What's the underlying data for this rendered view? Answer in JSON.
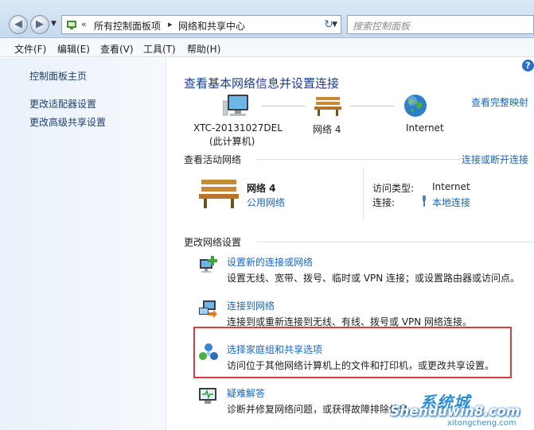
{
  "address": {
    "recent_symbol": "«",
    "crumbs": [
      "所有控制面板项",
      "网络和共享中心"
    ],
    "search_placeholder": "搜索控制面板"
  },
  "menu": [
    "文件(F)",
    "编辑(E)",
    "查看(V)",
    "工具(T)",
    "帮助(H)"
  ],
  "sidebar": {
    "home": "控制面板主页",
    "items": [
      "更改适配器设置",
      "更改高级共享设置"
    ]
  },
  "main": {
    "title": "查看基本网络信息并设置连接",
    "full_map_link": "查看完整映射",
    "nodes": [
      {
        "label": "XTC-20131027DEL",
        "sublabel": "(此计算机)",
        "icon": "computer-icon"
      },
      {
        "label": "网络  4",
        "icon": "bench-icon"
      },
      {
        "label": "Internet",
        "icon": "globe-icon"
      }
    ],
    "active_networks_label": "查看活动网络",
    "connect_disconnect_link": "连接或断开连接",
    "network": {
      "name": "网络  4",
      "type_link": "公用网络",
      "access_type_label": "访问类型:",
      "access_type_value": "Internet",
      "connection_label": "连接:",
      "connection_value": "本地连接"
    },
    "change_settings_label": "更改网络设置",
    "tasks": [
      {
        "title": "设置新的连接或网络",
        "desc": "设置无线、宽带、拨号、临时或 VPN 连接；或设置路由器或访问点。",
        "icon": "new-connection-icon"
      },
      {
        "title": "连接到网络",
        "desc": "连接到或重新连接到无线、有线、拨号或 VPN 网络连接。",
        "icon": "connect-network-icon"
      },
      {
        "title": "选择家庭组和共享选项",
        "desc": "访问位于其他网络计算机上的文件和打印机，或更改共享设置。",
        "icon": "homegroup-icon"
      },
      {
        "title": "疑难解答",
        "desc": "诊断并修复网络问题，或获得故障排除信息。",
        "icon": "troubleshoot-icon"
      }
    ]
  },
  "watermark": {
    "top": "系统城",
    "main": "Shenduwin8.com",
    "sub": "xitongcheng.com"
  }
}
